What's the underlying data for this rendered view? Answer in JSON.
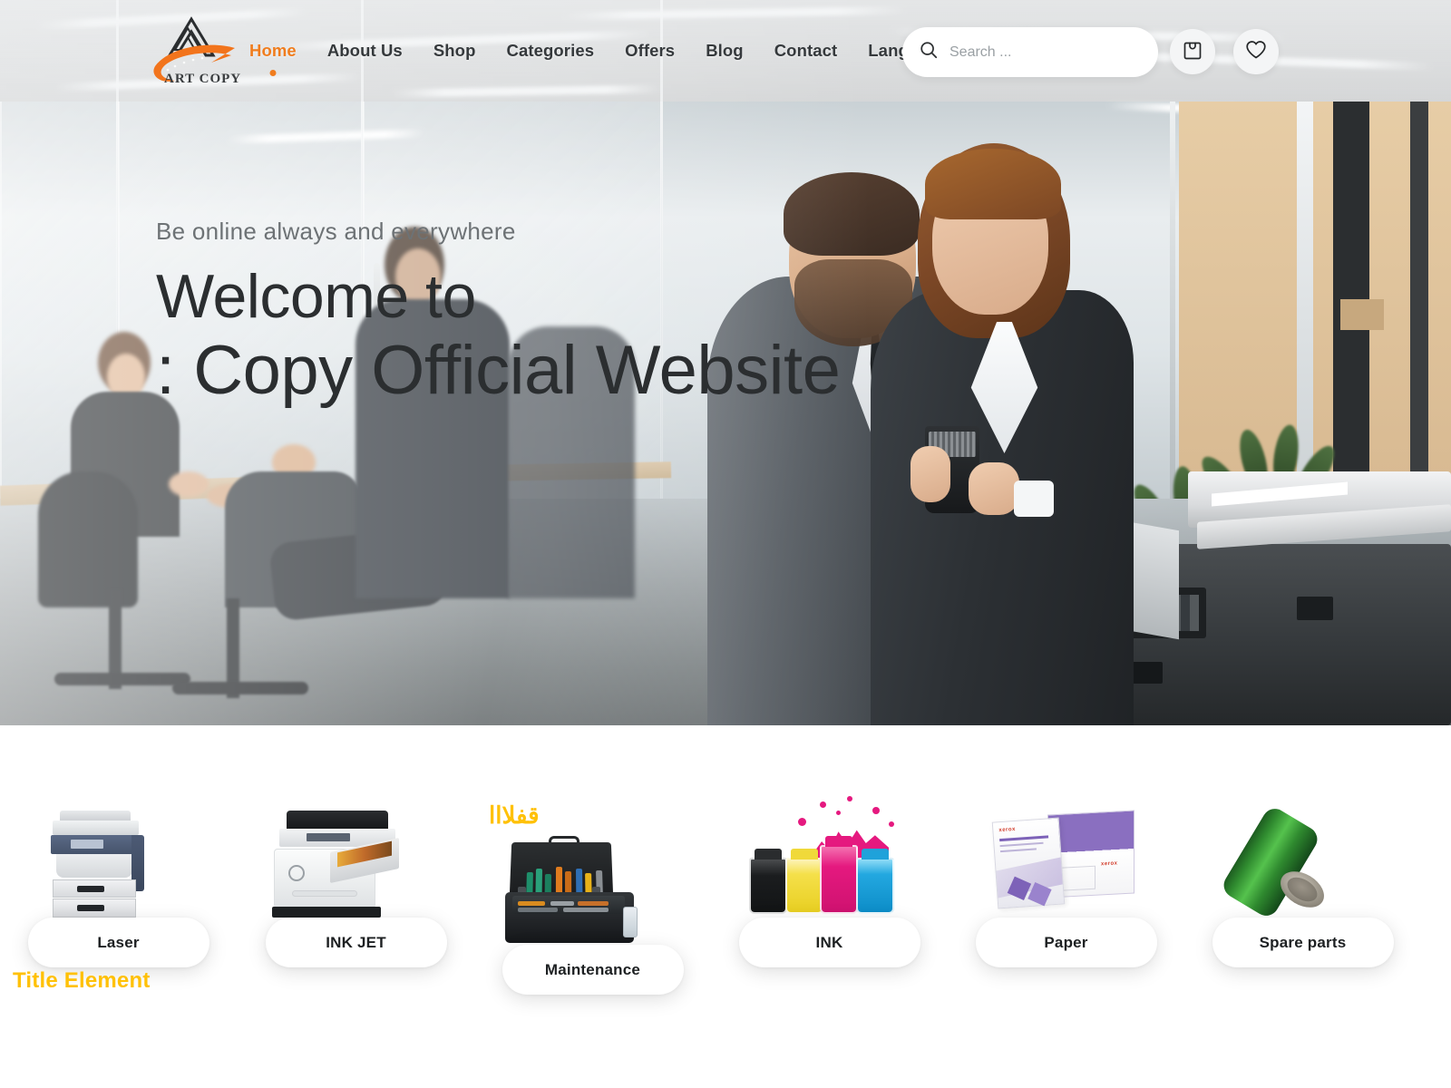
{
  "header": {
    "logo_text": "ART COPY",
    "nav": [
      {
        "label": "Home",
        "active": true
      },
      {
        "label": "About Us",
        "active": false
      },
      {
        "label": "Shop",
        "active": false
      },
      {
        "label": "Categories",
        "active": false
      },
      {
        "label": "Offers",
        "active": false
      },
      {
        "label": "Blog",
        "active": false
      },
      {
        "label": "Contact",
        "active": false
      }
    ],
    "language_menu_label": "Language Menu:",
    "language_flag": "uk-flag-icon",
    "search": {
      "placeholder": "Search ...",
      "value": "",
      "icon": "search-icon"
    },
    "cart_icon": "shopping-bag-icon",
    "wishlist_icon": "heart-icon"
  },
  "hero": {
    "kicker": "Be online always and everywhere",
    "line1": "Welcome to",
    "line2": ": Copy Official Website"
  },
  "categories": {
    "title_element": "Title Element",
    "arabic_badge": "قفلااا",
    "items": [
      {
        "label": "Laser",
        "art": "copier-image"
      },
      {
        "label": "INK JET",
        "art": "inkjet-printer-image"
      },
      {
        "label": "Maintenance",
        "art": "toolbox-image"
      },
      {
        "label": "INK",
        "art": "ink-bottles-image"
      },
      {
        "label": "Paper",
        "art": "paper-reams-image"
      },
      {
        "label": "Spare  parts",
        "art": "drum-roller-image"
      }
    ]
  },
  "colors": {
    "accent_orange": "#f07d1e",
    "accent_yellow": "#FFC107",
    "nav_text": "#35393c",
    "hero_text": "#2b2e30",
    "hero_kicker": "#6d7275"
  }
}
